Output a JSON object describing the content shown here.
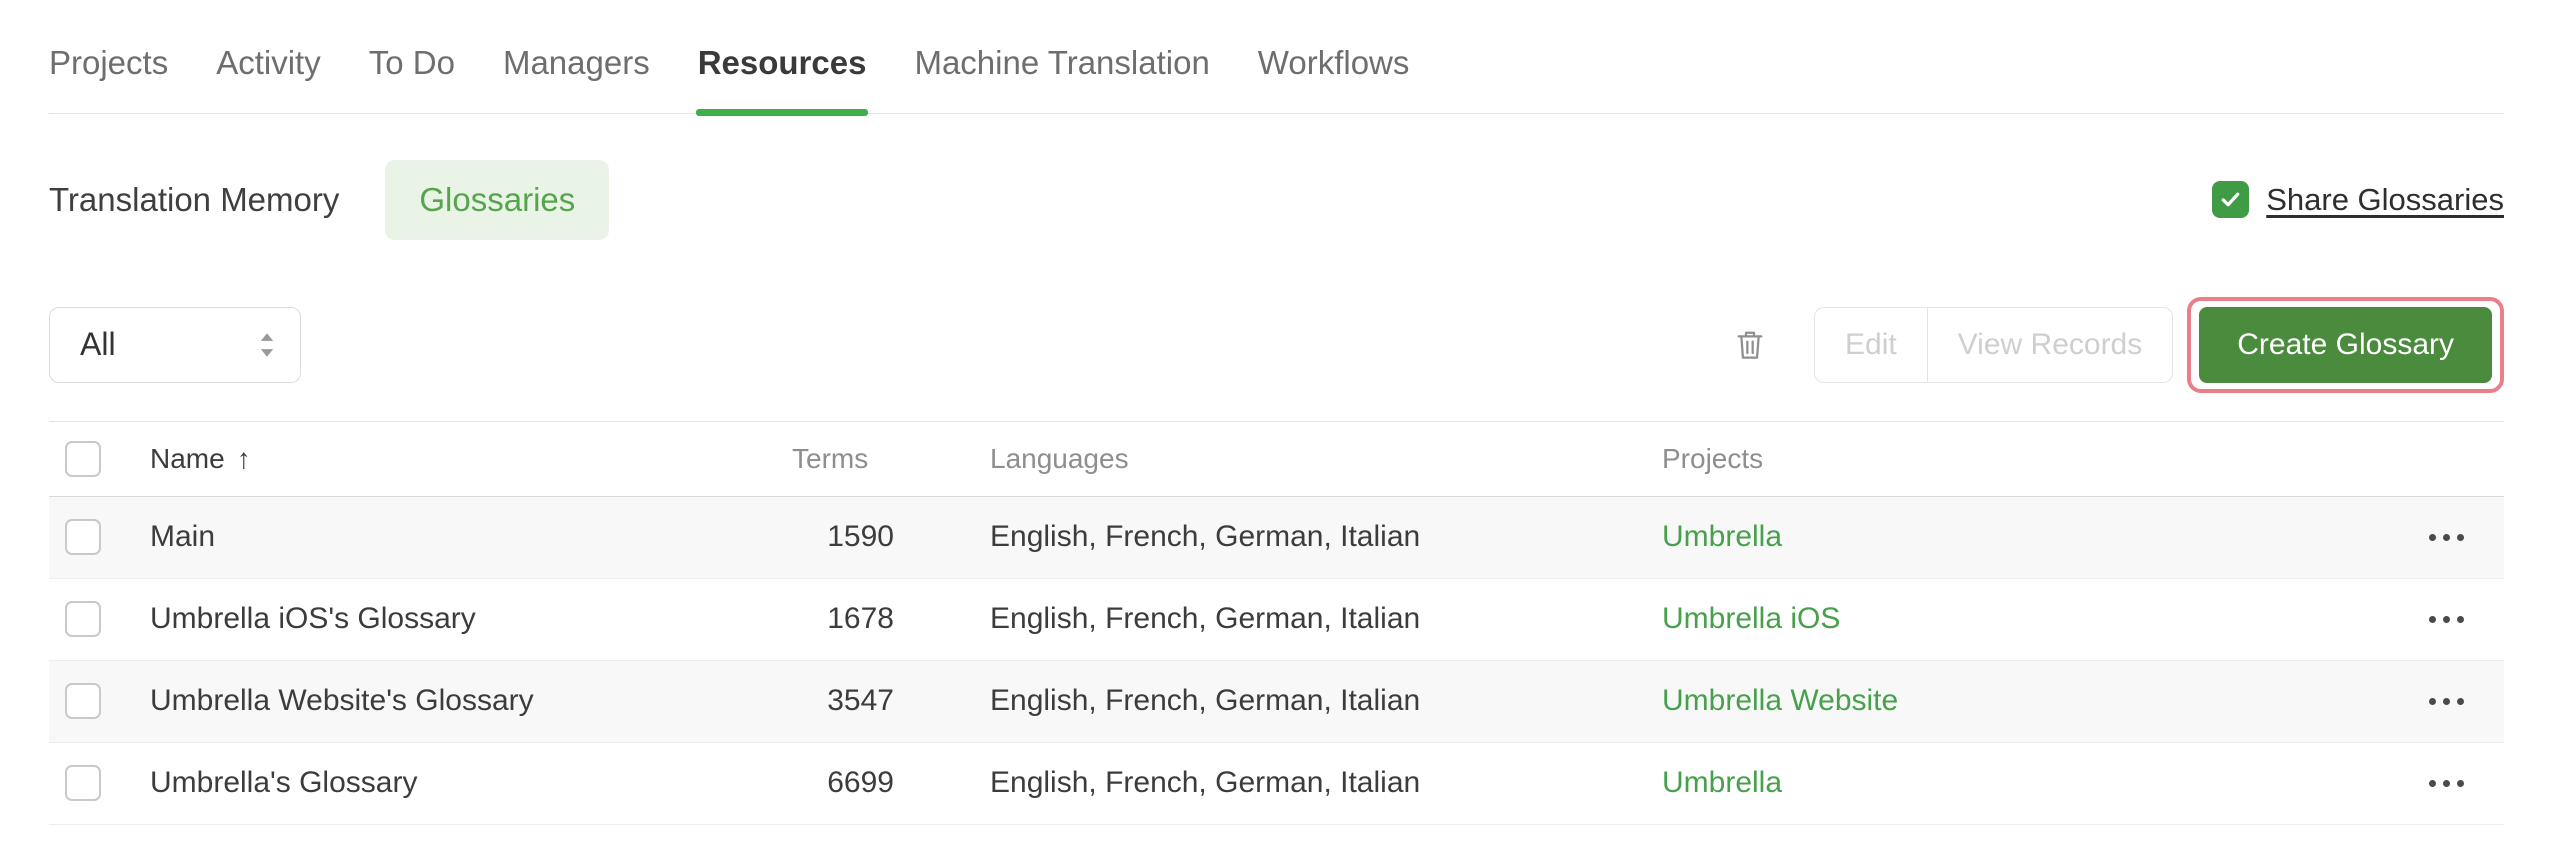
{
  "nav": {
    "tabs": [
      {
        "id": "projects",
        "label": "Projects",
        "active": false
      },
      {
        "id": "activity",
        "label": "Activity",
        "active": false
      },
      {
        "id": "todo",
        "label": "To Do",
        "active": false
      },
      {
        "id": "managers",
        "label": "Managers",
        "active": false
      },
      {
        "id": "resources",
        "label": "Resources",
        "active": true
      },
      {
        "id": "machine-translation",
        "label": "Machine Translation",
        "active": false
      },
      {
        "id": "workflows",
        "label": "Workflows",
        "active": false
      }
    ]
  },
  "subtabs": {
    "items": [
      {
        "id": "translation-memory",
        "label": "Translation Memory",
        "active": false
      },
      {
        "id": "glossaries",
        "label": "Glossaries",
        "active": true
      }
    ]
  },
  "share": {
    "label": "Share Glossaries",
    "checked": true
  },
  "toolbar": {
    "filter_value": "All",
    "edit_label": "Edit",
    "view_records_label": "View Records",
    "create_label": "Create Glossary"
  },
  "table": {
    "headers": {
      "name": "Name",
      "terms": "Terms",
      "languages": "Languages",
      "projects": "Projects"
    },
    "sort": {
      "column": "Name",
      "direction": "asc",
      "icon": "↑"
    },
    "rows": [
      {
        "name": "Main",
        "terms": "1590",
        "languages": "English, French, German, Italian",
        "project": "Umbrella",
        "checked": false
      },
      {
        "name": "Umbrella iOS's Glossary",
        "terms": "1678",
        "languages": "English, French, German, Italian",
        "project": "Umbrella iOS",
        "checked": false
      },
      {
        "name": "Umbrella Website's Glossary",
        "terms": "3547",
        "languages": "English, French, German, Italian",
        "project": "Umbrella Website",
        "checked": false
      },
      {
        "name": "Umbrella's Glossary",
        "terms": "6699",
        "languages": "English, French, German, Italian",
        "project": "Umbrella",
        "checked": false
      }
    ]
  },
  "colors": {
    "active_tab_underline": "#3faf49",
    "pill_bg": "#e9f4e7",
    "pill_text": "#56a44b",
    "checkbox_green": "#3f9c44",
    "button_green": "#4a8b3d",
    "link_green": "#47a04b",
    "highlight_border": "#e87f8a",
    "disabled_text": "#cfcfcf"
  }
}
